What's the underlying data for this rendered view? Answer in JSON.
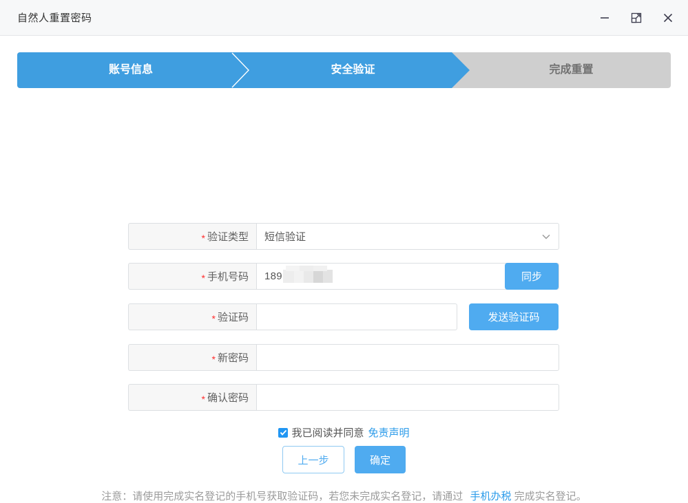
{
  "window": {
    "title": "自然人重置密码",
    "controls": {
      "minimize": "minimize",
      "maximize": "maximize",
      "close": "close"
    }
  },
  "steps": [
    {
      "label": "账号信息",
      "state": "done"
    },
    {
      "label": "安全验证",
      "state": "active"
    },
    {
      "label": "完成重置",
      "state": "pending"
    }
  ],
  "form": {
    "verify_type": {
      "label": "验证类型",
      "required": "*",
      "value": "短信验证",
      "icon": "chevron-down-icon"
    },
    "phone": {
      "label": "手机号码",
      "required": "*",
      "value": "189",
      "redacted": true,
      "sync_button": "同步"
    },
    "code": {
      "label": "验证码",
      "required": "*",
      "value": "",
      "placeholder": "",
      "send_button": "发送验证码"
    },
    "new_password": {
      "label": "新密码",
      "required": "*",
      "value": "",
      "placeholder": ""
    },
    "confirm_password": {
      "label": "确认密码",
      "required": "*",
      "value": "",
      "placeholder": ""
    }
  },
  "agreement": {
    "checked": true,
    "text": "我已阅读并同意",
    "link": "免责声明"
  },
  "actions": {
    "previous": "上一步",
    "confirm": "确定"
  },
  "notice": {
    "part1": "注意：请使用完成实名登记的手机号获取验证码，若您未完成实名登记，请通过",
    "link": "手机办税",
    "part2": "完成实名登记。"
  },
  "colors": {
    "accent": "#4fabf0",
    "step_active": "#3f9ee0",
    "step_pending": "#cfcfcf",
    "required_star": "#ff2d2d",
    "link": "#2b9bea"
  }
}
